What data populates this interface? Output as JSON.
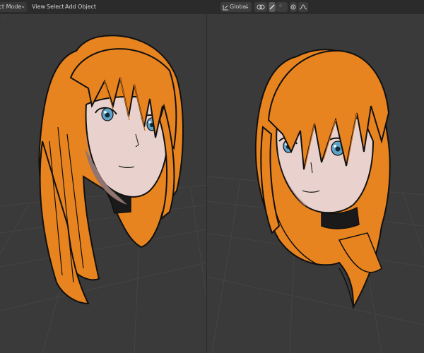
{
  "header": {
    "mode_label": "Object Mode",
    "menus": [
      "View",
      "Select",
      "Add",
      "Object"
    ],
    "orientation_label": "Global",
    "snap_label": "⁘"
  },
  "icons": {
    "mode": "object-mode-chevron-icon",
    "orientation": "transform-orientation-icon",
    "pivot": "pivot-link-icon",
    "snap": "snap-magnet-icon",
    "proportional": "proportional-edit-icon",
    "falloff": "falloff-curve-icon"
  },
  "colors": {
    "hair": "#e8841f",
    "hair_dark": "#c96a12",
    "skin": "#e9d2cd",
    "skin_shadow": "#b3918d",
    "eye": "#5fa4c8",
    "outline": "#101010",
    "viewport": "#3a3a3a"
  }
}
